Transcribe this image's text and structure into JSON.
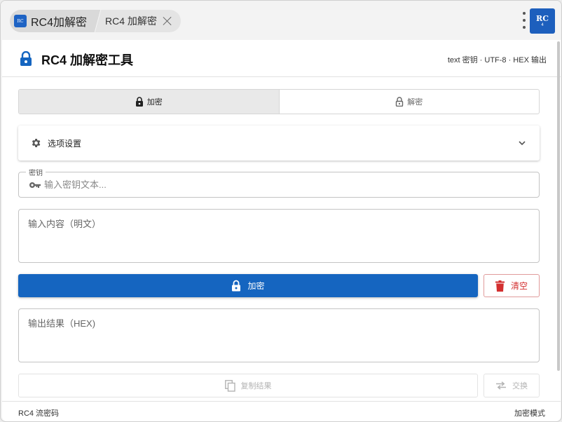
{
  "tabs": [
    {
      "label": "RC4加解密",
      "active": true
    },
    {
      "label": "RC4 加解密",
      "active": false
    }
  ],
  "brand": {
    "rc": "RC",
    "num": "4"
  },
  "header": {
    "title": "RC4 加解密工具",
    "meta": "text 密钥 · UTF-8 · HEX 输出"
  },
  "mode": {
    "encrypt_label": "加密",
    "decrypt_label": "解密",
    "selected": "encrypt"
  },
  "options": {
    "label": "选项设置"
  },
  "key": {
    "legend": "密钥",
    "placeholder": "输入密钥文本...",
    "value": ""
  },
  "input": {
    "placeholder": "输入内容（明文）",
    "value": ""
  },
  "actions": {
    "encrypt_label": "加密",
    "clear_label": "清空"
  },
  "output": {
    "placeholder": "输出结果（HEX)",
    "value": ""
  },
  "secondary": {
    "copy_label": "复制结果",
    "swap_label": "交换"
  },
  "footer": {
    "left": "RC4 流密码",
    "right": "加密模式"
  },
  "colors": {
    "primary": "#1565c0",
    "danger": "#d32f2f",
    "brand": "#1d5fbd"
  }
}
